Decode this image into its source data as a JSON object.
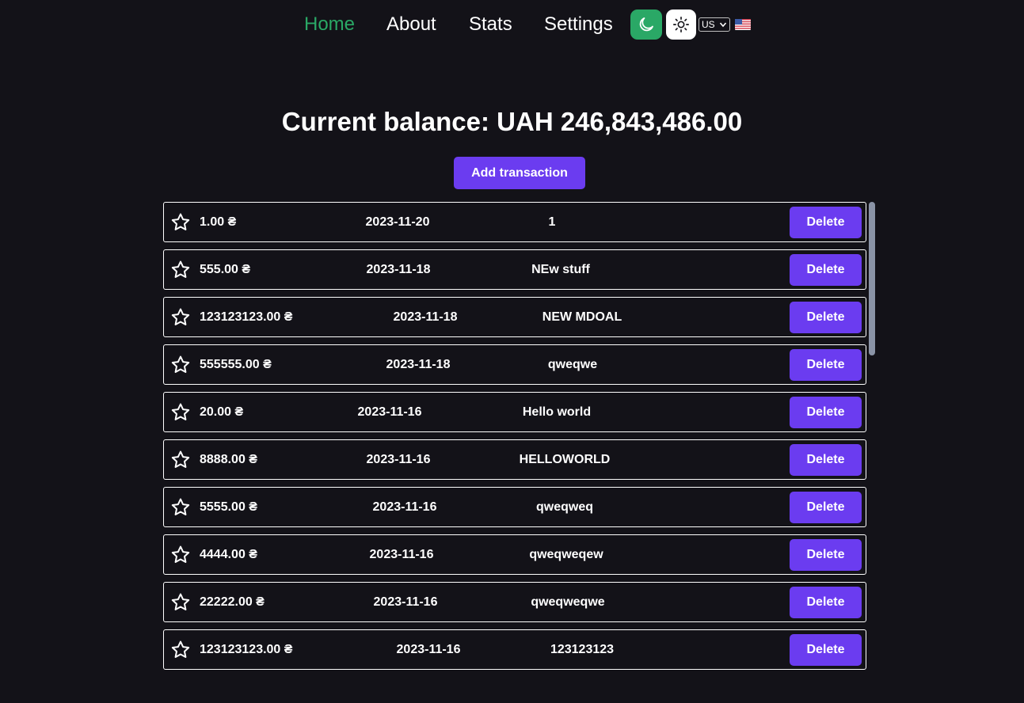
{
  "nav": {
    "links": [
      "Home",
      "About",
      "Stats",
      "Settings"
    ],
    "active_color": "#2aa866",
    "language": "US",
    "flag": "us-flag-icon"
  },
  "balance_text": "Current balance: UAH 246,843,486.00",
  "add_button_label": "Add transaction",
  "delete_label": "Delete",
  "colors": {
    "background": "#131218",
    "accent": "#6b3cf0",
    "active": "#2aa866"
  },
  "transactions": [
    {
      "amount": "1.00 ₴",
      "date": "2023-11-20",
      "description": "1"
    },
    {
      "amount": "555.00 ₴",
      "date": "2023-11-18",
      "description": "NEw stuff"
    },
    {
      "amount": "123123123.00 ₴",
      "date": "2023-11-18",
      "description": "NEW MDOAL"
    },
    {
      "amount": "555555.00 ₴",
      "date": "2023-11-18",
      "description": "qweqwe"
    },
    {
      "amount": "20.00 ₴",
      "date": "2023-11-16",
      "description": "Hello world"
    },
    {
      "amount": "8888.00 ₴",
      "date": "2023-11-16",
      "description": "HELLOWORLD"
    },
    {
      "amount": "5555.00 ₴",
      "date": "2023-11-16",
      "description": "qweqweq"
    },
    {
      "amount": "4444.00 ₴",
      "date": "2023-11-16",
      "description": "qweqweqew"
    },
    {
      "amount": "22222.00 ₴",
      "date": "2023-11-16",
      "description": "qweqweqwe"
    },
    {
      "amount": "123123123.00 ₴",
      "date": "2023-11-16",
      "description": "123123123"
    }
  ]
}
